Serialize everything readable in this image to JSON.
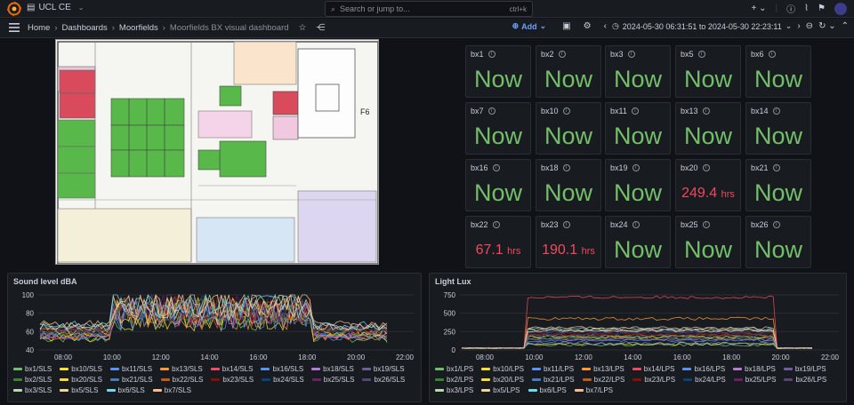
{
  "topbar": {
    "org_name": "UCL CE",
    "search_placeholder": "Search or jump to...",
    "search_shortcut": "ctrl+k",
    "new_label": "+"
  },
  "breadcrumbs": [
    {
      "label": "Home"
    },
    {
      "label": "Dashboards"
    },
    {
      "label": "Moorfields"
    },
    {
      "label": "Moorfields BX visual dashboard"
    }
  ],
  "toolbar": {
    "add_label": "Add",
    "time_range": "2024-05-30 06:31:51 to 2024-05-30 22:23:11"
  },
  "floorplan": {
    "label": "F6"
  },
  "colors": {
    "green": "#73bf69",
    "red": "#f2495c",
    "accent": "#6e9fff"
  },
  "stats": [
    {
      "name": "bx1",
      "value": "Now",
      "unit": "",
      "status": "ok"
    },
    {
      "name": "bx2",
      "value": "Now",
      "unit": "",
      "status": "ok"
    },
    {
      "name": "bx3",
      "value": "Now",
      "unit": "",
      "status": "ok"
    },
    {
      "name": "bx5",
      "value": "Now",
      "unit": "",
      "status": "ok"
    },
    {
      "name": "bx6",
      "value": "Now",
      "unit": "",
      "status": "ok"
    },
    {
      "name": "bx7",
      "value": "Now",
      "unit": "",
      "status": "ok"
    },
    {
      "name": "bx10",
      "value": "Now",
      "unit": "",
      "status": "ok"
    },
    {
      "name": "bx11",
      "value": "Now",
      "unit": "",
      "status": "ok"
    },
    {
      "name": "bx13",
      "value": "Now",
      "unit": "",
      "status": "ok"
    },
    {
      "name": "bx14",
      "value": "Now",
      "unit": "",
      "status": "ok"
    },
    {
      "name": "bx16",
      "value": "Now",
      "unit": "",
      "status": "ok"
    },
    {
      "name": "bx18",
      "value": "Now",
      "unit": "",
      "status": "ok"
    },
    {
      "name": "bx19",
      "value": "Now",
      "unit": "",
      "status": "ok"
    },
    {
      "name": "bx20",
      "value": "249.4",
      "unit": "hrs",
      "status": "alert"
    },
    {
      "name": "bx21",
      "value": "Now",
      "unit": "",
      "status": "ok"
    },
    {
      "name": "bx22",
      "value": "67.1",
      "unit": "hrs",
      "status": "alert"
    },
    {
      "name": "bx23",
      "value": "190.1",
      "unit": "hrs",
      "status": "alert"
    },
    {
      "name": "bx24",
      "value": "Now",
      "unit": "",
      "status": "ok"
    },
    {
      "name": "bx25",
      "value": "Now",
      "unit": "",
      "status": "ok"
    },
    {
      "name": "bx26",
      "value": "Now",
      "unit": "",
      "status": "ok"
    }
  ],
  "chart_data": [
    {
      "type": "line",
      "title": "Sound level dBA",
      "x_ticks": [
        "08:00",
        "10:00",
        "12:00",
        "14:00",
        "16:00",
        "18:00",
        "20:00",
        "22:00"
      ],
      "y_ticks": [
        40,
        60,
        80,
        100
      ],
      "ylim": [
        40,
        100
      ],
      "series": [
        {
          "name": "bx1/SLS",
          "color": "#73bf69"
        },
        {
          "name": "bx10/SLS",
          "color": "#fade2a"
        },
        {
          "name": "bx11/SLS",
          "color": "#5794f2"
        },
        {
          "name": "bx13/SLS",
          "color": "#ff9830"
        },
        {
          "name": "bx14/SLS",
          "color": "#f2495c"
        },
        {
          "name": "bx16/SLS",
          "color": "#5794f2"
        },
        {
          "name": "bx18/SLS",
          "color": "#b877d9"
        },
        {
          "name": "bx19/SLS",
          "color": "#705da0"
        },
        {
          "name": "bx2/SLS",
          "color": "#37872d"
        },
        {
          "name": "bx20/SLS",
          "color": "#fade2a"
        },
        {
          "name": "bx21/SLS",
          "color": "#447ebc"
        },
        {
          "name": "bx22/SLS",
          "color": "#c15c17"
        },
        {
          "name": "bx23/SLS",
          "color": "#890f02"
        },
        {
          "name": "bx24/SLS",
          "color": "#0a437c"
        },
        {
          "name": "bx25/SLS",
          "color": "#6d1f62"
        },
        {
          "name": "bx26/SLS",
          "color": "#584477"
        },
        {
          "name": "bx3/SLS",
          "color": "#b7dbab"
        },
        {
          "name": "bx5/SLS",
          "color": "#f4d598"
        },
        {
          "name": "bx6/SLS",
          "color": "#70dbed"
        },
        {
          "name": "bx7/SLS",
          "color": "#f9ba8f"
        }
      ]
    },
    {
      "type": "line",
      "title": "Light Lux",
      "x_ticks": [
        "08:00",
        "10:00",
        "12:00",
        "14:00",
        "16:00",
        "18:00",
        "20:00",
        "22:00"
      ],
      "y_ticks": [
        0,
        250,
        500,
        750
      ],
      "ylim": [
        0,
        750
      ],
      "series": [
        {
          "name": "bx1/LPS",
          "color": "#73bf69"
        },
        {
          "name": "bx10/LPS",
          "color": "#fade2a"
        },
        {
          "name": "bx11/LPS",
          "color": "#5794f2"
        },
        {
          "name": "bx13/LPS",
          "color": "#ff9830"
        },
        {
          "name": "bx14/LPS",
          "color": "#f2495c"
        },
        {
          "name": "bx16/LPS",
          "color": "#5794f2"
        },
        {
          "name": "bx18/LPS",
          "color": "#b877d9"
        },
        {
          "name": "bx19/LPS",
          "color": "#705da0"
        },
        {
          "name": "bx2/LPS",
          "color": "#37872d"
        },
        {
          "name": "bx20/LPS",
          "color": "#fade2a"
        },
        {
          "name": "bx21/LPS",
          "color": "#447ebc"
        },
        {
          "name": "bx22/LPS",
          "color": "#c15c17"
        },
        {
          "name": "bx23/LPS",
          "color": "#890f02"
        },
        {
          "name": "bx24/LPS",
          "color": "#0a437c"
        },
        {
          "name": "bx25/LPS",
          "color": "#6d1f62"
        },
        {
          "name": "bx26/LPS",
          "color": "#584477"
        },
        {
          "name": "bx3/LPS",
          "color": "#b7dbab"
        },
        {
          "name": "bx5/LPS",
          "color": "#f4d598"
        },
        {
          "name": "bx6/LPS",
          "color": "#70dbed"
        },
        {
          "name": "bx7/LPS",
          "color": "#f9ba8f"
        }
      ]
    }
  ]
}
